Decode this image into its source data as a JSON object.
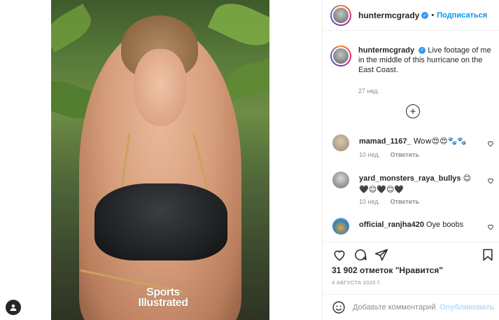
{
  "post": {
    "author": "huntermcgrady",
    "follow_label": "Подписаться",
    "separator": "•",
    "image_logo": [
      "Sports",
      "Illustrated"
    ]
  },
  "caption": {
    "username": "huntermcgrady",
    "text": "Live footage of me in the middle of this hurricane on the East Coast.",
    "time": "27 нед."
  },
  "comments": [
    {
      "username": "mamad_1167_",
      "text": "Wow😍😍🐾🐾",
      "time": "10 нед.",
      "reply": "Ответить"
    },
    {
      "username": "yard_monsters_raya_bullys",
      "text": "😊🖤😊🖤😊🖤",
      "time": "10 нед.",
      "reply": "Ответить"
    },
    {
      "username": "official_ranjha420",
      "text": "Oye boobs",
      "time": "",
      "reply": ""
    }
  ],
  "likes": "31 902 отметок \"Нравится\"",
  "date": "4 АВГУСТА 2020 Г.",
  "add_comment": {
    "placeholder": "Добавьте комментарий...",
    "post_label": "Опубликовать"
  },
  "icons": {
    "like": "heart-icon",
    "comment": "comment-icon",
    "share": "paper-plane-icon",
    "save": "bookmark-icon",
    "emoji": "smiley-icon",
    "load_more": "plus-circle-icon",
    "verified": "verified-badge-icon",
    "profile": "user-icon"
  },
  "colors": {
    "accent_blue": "#0095f6",
    "verified_blue": "#3897f0",
    "muted_text": "#8e8e8e",
    "post_disabled": "#b3dbff"
  }
}
